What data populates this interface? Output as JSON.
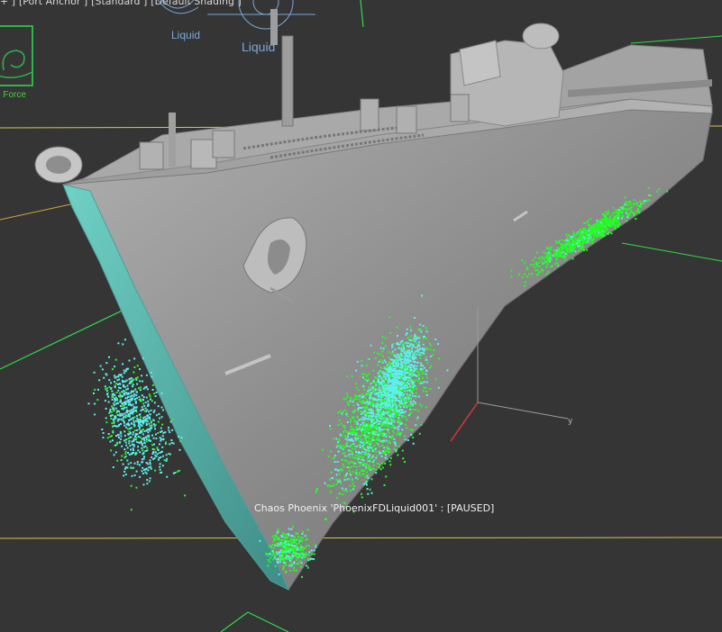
{
  "viewport": {
    "labels": [
      "+ ]",
      "[Port Anchor ]",
      "[Standard ]",
      "[Default Shading ]"
    ],
    "status_text": "Chaos Phoenix 'PhoenixFDLiquid001' : [PAUSED]"
  },
  "helpers": {
    "liquid_icon_1_label": "Liquid",
    "liquid_icon_2_label": "Liquid",
    "force_label": "e Force"
  },
  "colors": {
    "background": "#353535",
    "grid_line": "#d4c94a",
    "helper_green": "#2fdc4a",
    "particle_cyan": "#5ff0f0",
    "particle_green": "#22ff22",
    "hull": "#9a9a9a",
    "bow_water": "#5fb8b0"
  },
  "icons": [
    "liquid-icon",
    "liquid-icon",
    "force-field-icon",
    "axis-gizmo-icon",
    "anchor-icon"
  ]
}
